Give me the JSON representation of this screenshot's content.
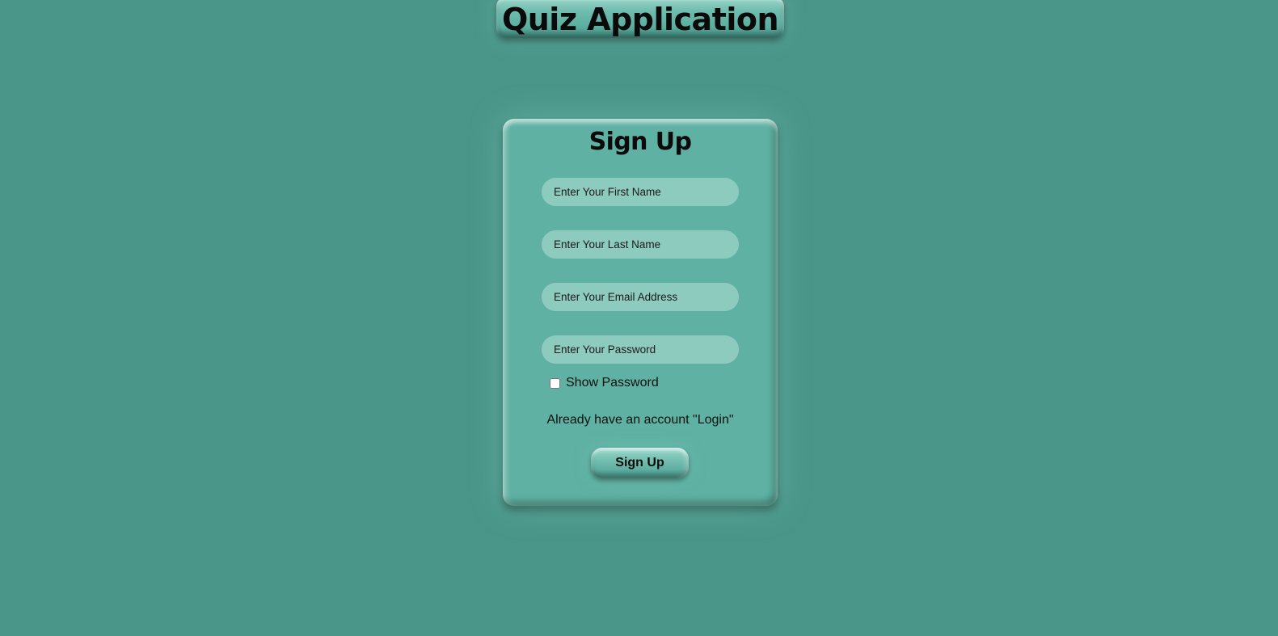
{
  "header": {
    "title": "Quiz Application"
  },
  "signup_form": {
    "title": "Sign Up",
    "fields": {
      "first_name_placeholder": "Enter Your First Name",
      "last_name_placeholder": "Enter Your Last Name",
      "email_placeholder": "Enter Your Email Address",
      "password_placeholder": "Enter Your Password"
    },
    "show_password_label": "Show Password",
    "show_password_checked": false,
    "login_link_text": "Already have an account \"Login\"",
    "submit_label": "Sign Up"
  },
  "colors": {
    "background": "#4a9789",
    "card": "#5eb1a3",
    "input": "#8ecbbf"
  }
}
